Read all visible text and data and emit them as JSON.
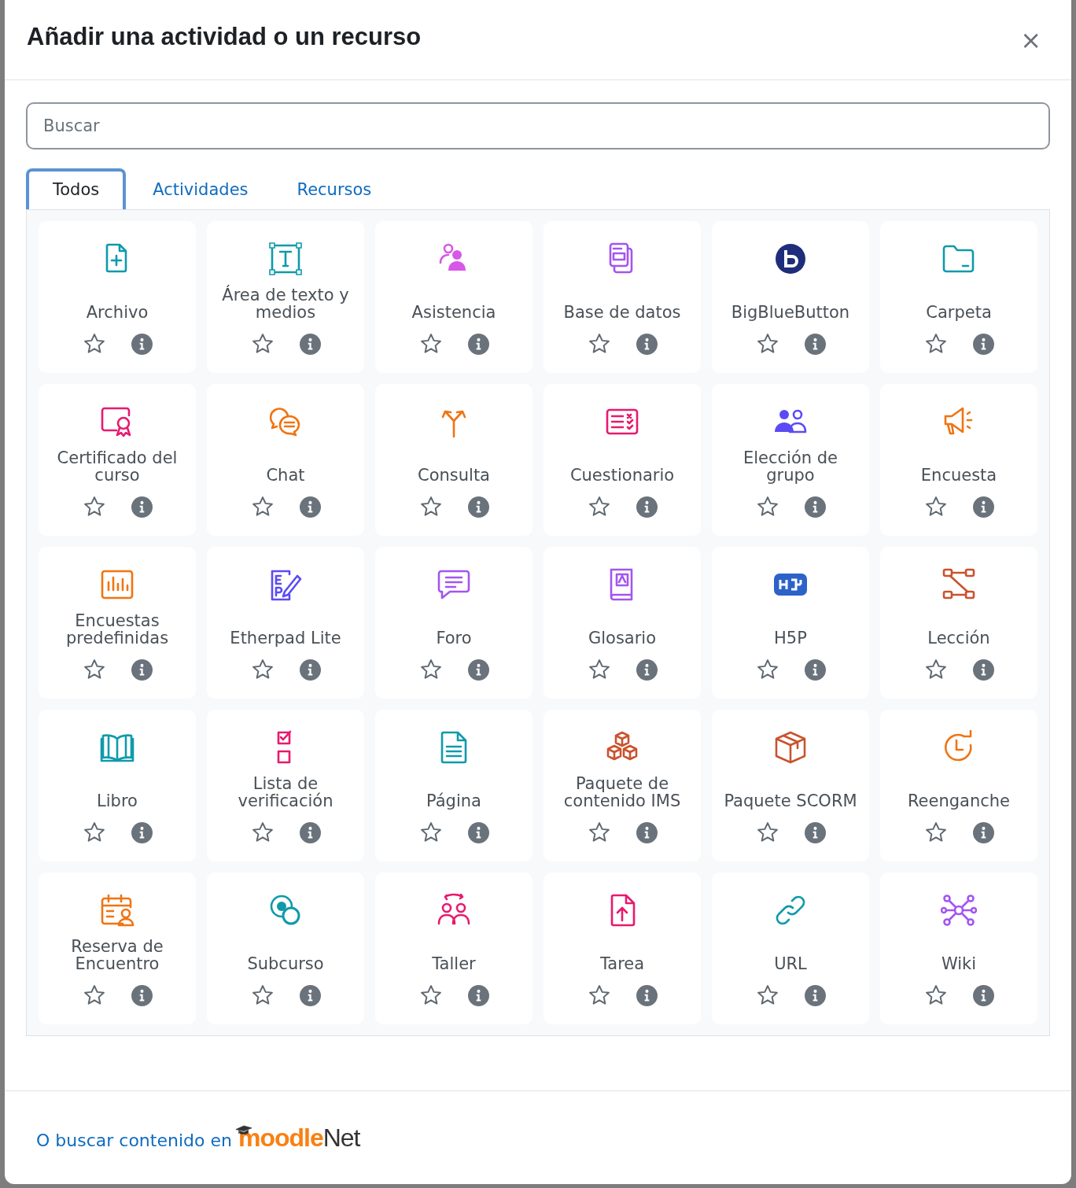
{
  "dialog": {
    "title": "Añadir una actividad o un recurso",
    "close": "×"
  },
  "search": {
    "placeholder": "Buscar"
  },
  "tabs": [
    {
      "label": "Todos",
      "selected": true
    },
    {
      "label": "Actividades",
      "selected": false
    },
    {
      "label": "Recursos",
      "selected": false
    }
  ],
  "items": [
    {
      "name": "Archivo",
      "kind": "fileplus",
      "color": "#0f9aab",
      "starred": false
    },
    {
      "name": "Área de texto y medios",
      "kind": "textframe",
      "color": "#0f9aab",
      "starred": false
    },
    {
      "name": "Asistencia",
      "kind": "people",
      "color": "#d857e8",
      "starred": false
    },
    {
      "name": "Base de datos",
      "kind": "database",
      "color": "#a455f0",
      "starred": false
    },
    {
      "name": "BigBlueButton",
      "kind": "bbb",
      "color": "#1f2e7a",
      "starred": false
    },
    {
      "name": "Carpeta",
      "kind": "folder",
      "color": "#0f9aab",
      "starred": false
    },
    {
      "name": "Certificado del curso",
      "kind": "certificate",
      "color": "#e8196f",
      "starred": false
    },
    {
      "name": "Chat",
      "kind": "chat",
      "color": "#f07412",
      "starred": false
    },
    {
      "name": "Consulta",
      "kind": "signpost",
      "color": "#f07412",
      "starred": false
    },
    {
      "name": "Cuestionario",
      "kind": "quiz",
      "color": "#e8196f",
      "starred": false
    },
    {
      "name": "Elección de grupo",
      "kind": "group",
      "color": "#5b4bf5",
      "starred": false
    },
    {
      "name": "Encuesta",
      "kind": "megaphone",
      "color": "#f07412",
      "starred": false
    },
    {
      "name": "Encuestas predefinidas",
      "kind": "barchart",
      "color": "#f07412",
      "starred": false
    },
    {
      "name": "Etherpad Lite",
      "kind": "pad",
      "color": "#5b4bf5",
      "starred": false
    },
    {
      "name": "Foro",
      "kind": "speech",
      "color": "#a455f0",
      "starred": false
    },
    {
      "name": "Glosario",
      "kind": "book",
      "color": "#a455f0",
      "starred": false
    },
    {
      "name": "H5P",
      "kind": "badge",
      "color": "#2d62c9",
      "starred": false
    },
    {
      "name": "Lección",
      "kind": "flow",
      "color": "#c9532e",
      "starred": false
    },
    {
      "name": "Libro",
      "kind": "openbook",
      "color": "#0f9aab",
      "starred": false
    },
    {
      "name": "Lista de verificación",
      "kind": "checklist",
      "color": "#e8196f",
      "starred": false
    },
    {
      "name": "Página",
      "kind": "page",
      "color": "#0f9aab",
      "starred": false
    },
    {
      "name": "Paquete de contenido IMS",
      "kind": "cubes",
      "color": "#c9532e",
      "starred": false
    },
    {
      "name": "Paquete SCORM",
      "kind": "cube",
      "color": "#c9532e",
      "starred": false
    },
    {
      "name": "Reenganche",
      "kind": "clock",
      "color": "#f07412",
      "starred": false
    },
    {
      "name": "Reserva de Encuentro",
      "kind": "calendar",
      "color": "#f07412",
      "starred": false
    },
    {
      "name": "Subcurso",
      "kind": "circles",
      "color": "#0f9aab",
      "starred": false
    },
    {
      "name": "Taller",
      "kind": "workshop",
      "color": "#e8196f",
      "starred": false
    },
    {
      "name": "Tarea",
      "kind": "upload",
      "color": "#e8196f",
      "starred": false
    },
    {
      "name": "URL",
      "kind": "link",
      "color": "#0f9aab",
      "starred": false
    },
    {
      "name": "Wiki",
      "kind": "network",
      "color": "#a455f0",
      "starred": false
    }
  ],
  "footer": {
    "text": "O buscar contenido en",
    "logo_main": "moodle",
    "logo_suffix": "Net"
  }
}
